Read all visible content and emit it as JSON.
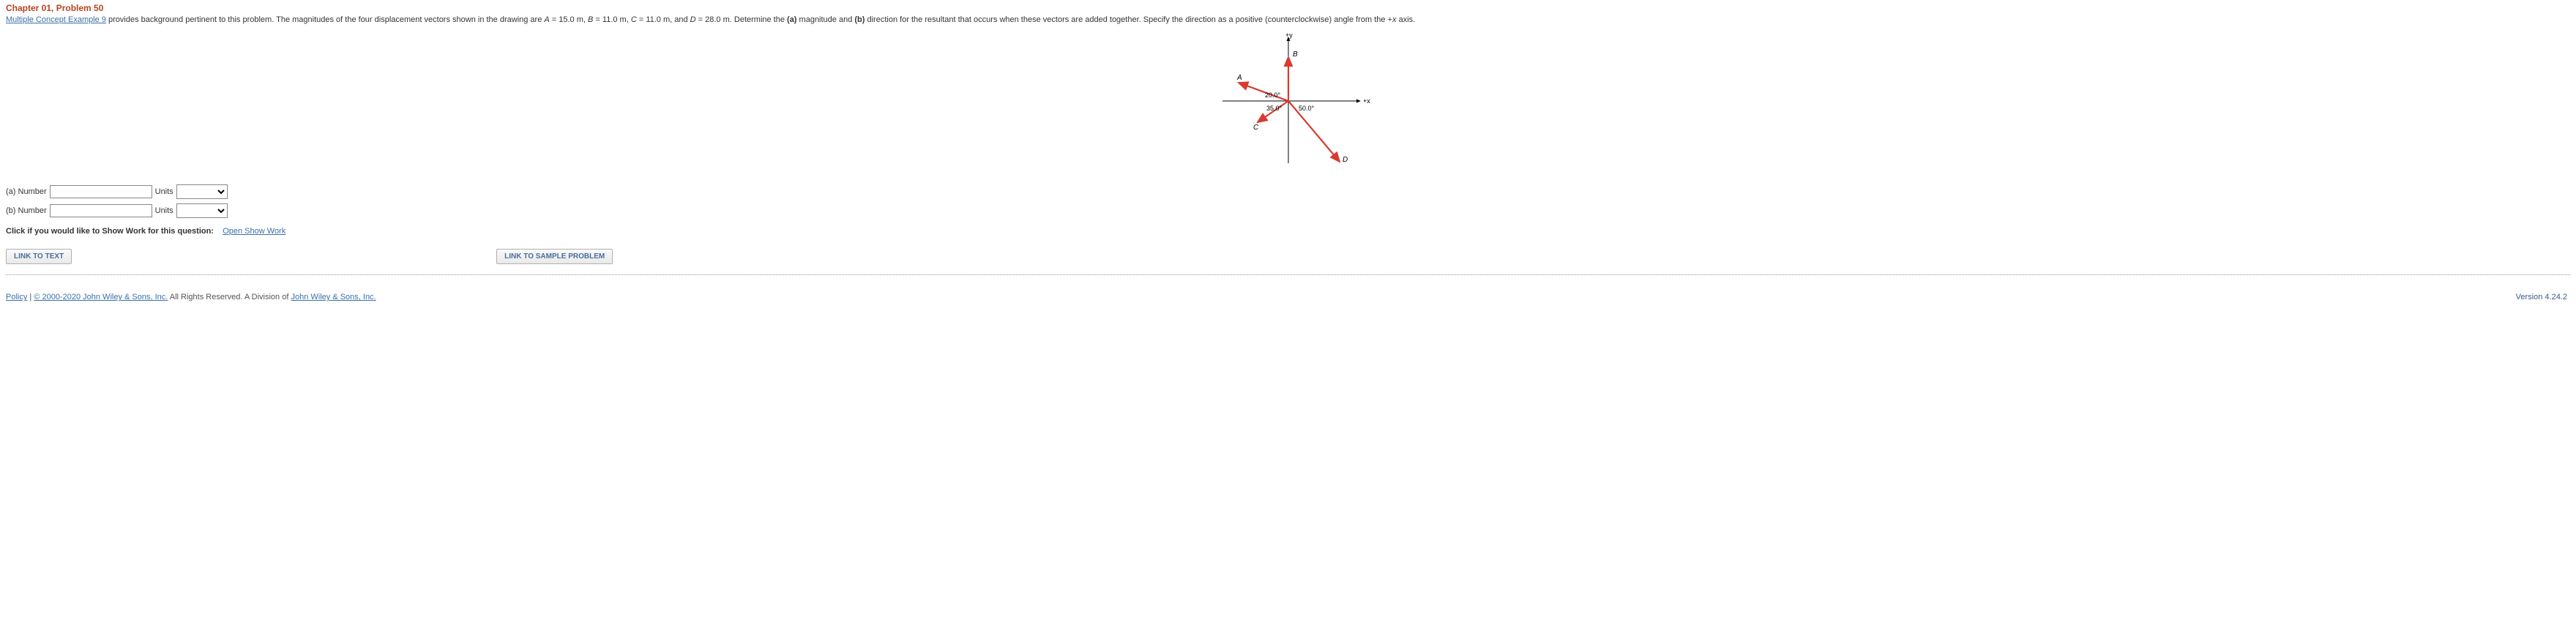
{
  "header": {
    "chapterProblem": "Chapter 01, Problem 50"
  },
  "problem": {
    "linkText": "Multiple Concept Example 9",
    "text1": " provides background pertinent to this problem. The magnitudes of the four displacement vectors shown in the drawing are ",
    "A_lhs": "A",
    "A_eq": " = 15.0 m, ",
    "B_lhs": "B",
    "B_eq": " = 11.0 m, ",
    "C_lhs": "C",
    "C_eq": " = 11.0 m, and ",
    "D_lhs": "D",
    "D_eq": " = 28.0 m. Determine the ",
    "part_a": "(a)",
    "mid1": " magnitude and ",
    "part_b": "(b)",
    "text2": " direction for the resultant that occurs when these vectors are added together. Specify the direction as a positive (counterclockwise) angle from the +",
    "x_lbl": "x",
    "text3": " axis."
  },
  "diagram": {
    "plusY": "+y",
    "plusX": "+x",
    "angA": "20.0°",
    "angB": "35.0°",
    "angD": "50.0°",
    "lblA": "A",
    "lblB": "B",
    "lblC": "C",
    "lblD": "D"
  },
  "answers": {
    "a_label": "(a) Number",
    "a_units_label": "Units",
    "b_label": "(b) Number",
    "b_units_label": "Units"
  },
  "showWork": {
    "prefix": "Click if you would like to Show Work for this question:",
    "linkText": "Open Show Work"
  },
  "buttons": {
    "linkToText": "LINK TO TEXT",
    "linkToSample": "LINK TO SAMPLE PROBLEM"
  },
  "footer": {
    "policy": "Policy",
    "sep": "   |   ",
    "copyright1": "© 2000-2020 John Wiley & Sons, Inc.",
    "mid": " All Rights Reserved. A Division of ",
    "copyright2": "John Wiley & Sons, Inc.",
    "version": "Version 4.24.2"
  }
}
